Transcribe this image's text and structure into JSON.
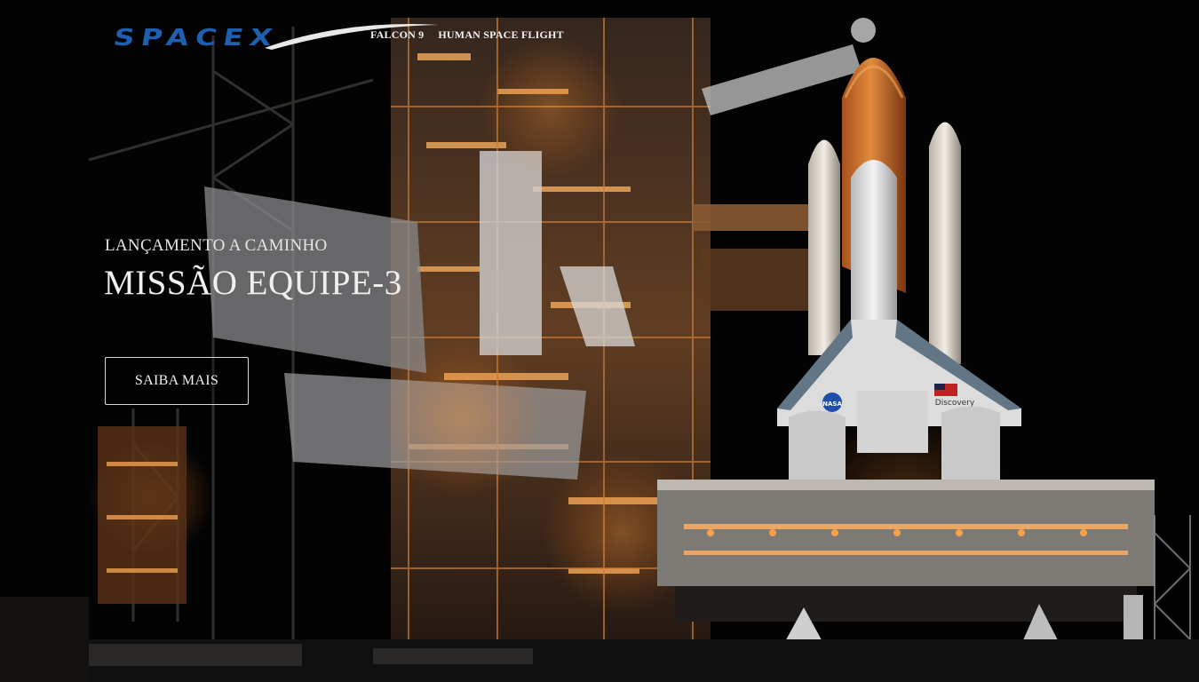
{
  "brand": {
    "logo_text": "SPACEX",
    "logo_color": "#1f5fb0"
  },
  "nav": {
    "items": [
      {
        "label": "FALCON 9"
      },
      {
        "label": "HUMAN SPACE FLIGHT"
      }
    ]
  },
  "hero": {
    "eyebrow": "LANÇAMENTO A CAMINHO",
    "title": "MISSÃO EQUIPE-3",
    "cta_label": "SAIBA MAIS",
    "background": "space-shuttle-launch-pad-at-night",
    "orbiter_label": "Discovery",
    "agency_badge": "NASA",
    "flag_icon": "us-flag-icon"
  }
}
